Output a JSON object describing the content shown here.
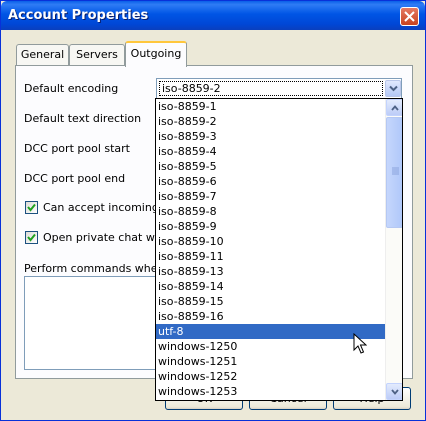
{
  "window": {
    "title": "Account Properties"
  },
  "tabs": [
    {
      "label": "General"
    },
    {
      "label": "Servers"
    },
    {
      "label": "Outgoing",
      "active": true
    }
  ],
  "fields": {
    "default_encoding_label": "Default encoding",
    "default_encoding_value": "iso-8859-2",
    "text_direction_label": "Default text direction",
    "dcc_start_label": "DCC port pool start",
    "dcc_end_label": "DCC port pool end",
    "accept_incoming_label": "Can accept incoming co",
    "accept_incoming_checked": true,
    "open_private_label": "Open private chat wind",
    "open_private_checked": true,
    "perform_commands_label": "Perform commands when co"
  },
  "dropdown": {
    "options": [
      "iso-8859-1",
      "iso-8859-2",
      "iso-8859-3",
      "iso-8859-4",
      "iso-8859-5",
      "iso-8859-6",
      "iso-8859-7",
      "iso-8859-8",
      "iso-8859-9",
      "iso-8859-10",
      "iso-8859-11",
      "iso-8859-13",
      "iso-8859-14",
      "iso-8859-15",
      "iso-8859-16",
      "utf-8",
      "windows-1250",
      "windows-1251",
      "windows-1252",
      "windows-1253"
    ],
    "highlighted": "utf-8"
  },
  "buttons": {
    "ok": "OK",
    "cancel": "Cancel",
    "help": "Help"
  },
  "colors": {
    "titlebar": "#0055e5",
    "selection": "#316ac5",
    "dialog_bg": "#ece9d8"
  },
  "icons": {
    "close": "close-icon",
    "combo_arrow": "chevron-down-icon",
    "cursor": "mouse-pointer-icon"
  }
}
